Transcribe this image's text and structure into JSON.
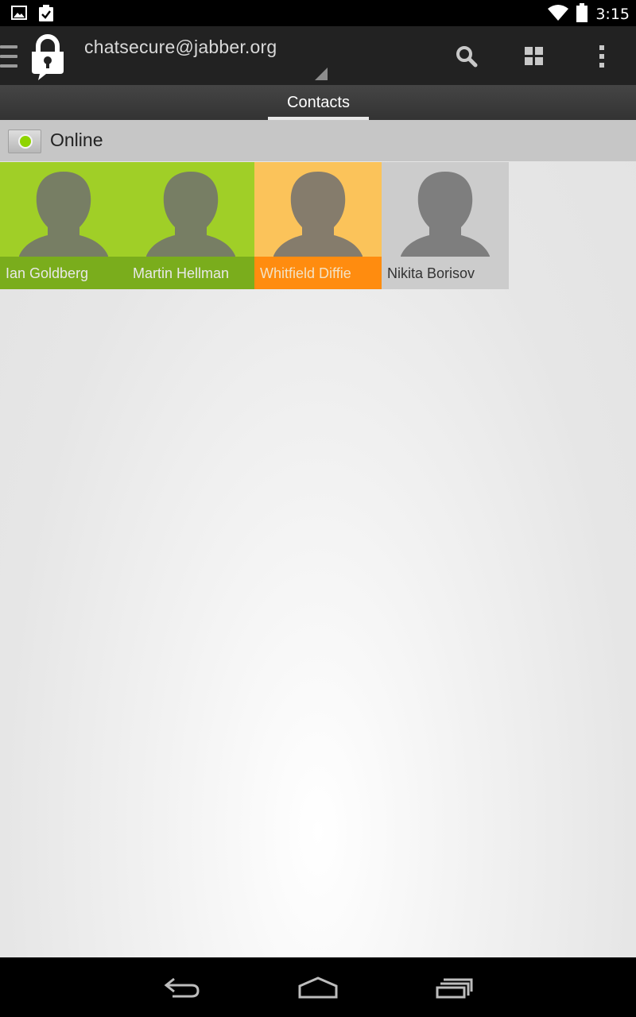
{
  "status_bar": {
    "time": "3:15",
    "left_icons": [
      "image-icon",
      "clipboard-check-icon"
    ],
    "right_icons": [
      "wifi-icon",
      "battery-icon"
    ]
  },
  "action_bar": {
    "account": "chatsecure@jabber.org",
    "icons": [
      "drawer-menu-icon",
      "chatsecure-lock-icon",
      "search-icon",
      "grid-view-icon",
      "overflow-menu-icon"
    ]
  },
  "tabs": [
    {
      "label": "Contacts",
      "selected": true
    }
  ],
  "presence": {
    "label": "Online",
    "color": "#8fd400"
  },
  "contacts": [
    {
      "name": "Ian Goldberg",
      "bg": "#a0cf27",
      "band": "#7aad1c",
      "name_color": "#e8e8e8"
    },
    {
      "name": "Martin Hellman",
      "bg": "#a0cf27",
      "band": "#7aad1c",
      "name_color": "#e8e8e8"
    },
    {
      "name": "Whitfield Diffie",
      "bg": "#fbc35a",
      "band": "#ff8c0f",
      "name_color": "#f3e2c4"
    },
    {
      "name": "Nikita Borisov",
      "bg": "#cccccc",
      "band": "#cccccc",
      "name_color": "#333333"
    }
  ],
  "nav_bar": {
    "icons": [
      "back-icon",
      "home-icon",
      "recents-icon"
    ]
  }
}
